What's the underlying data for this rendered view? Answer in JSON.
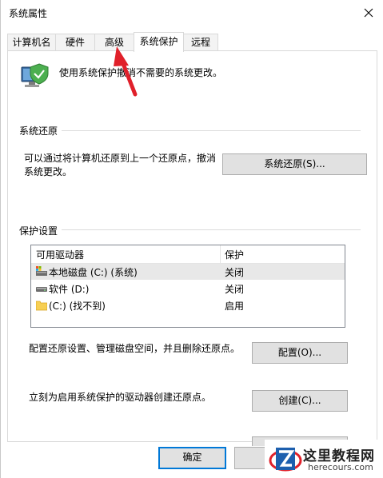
{
  "window": {
    "title": "系统属性"
  },
  "tabs": [
    {
      "label": "计算机名",
      "active": false
    },
    {
      "label": "硬件",
      "active": false
    },
    {
      "label": "高级",
      "active": false
    },
    {
      "label": "系统保护",
      "active": true
    },
    {
      "label": "远程",
      "active": false
    }
  ],
  "description": "使用系统保护撤消不需要的系统更改。",
  "restore": {
    "group_label": "系统还原",
    "text_line1": "可以通过将计算机还原到上一个还原点，撤消",
    "text_line2": "系统更改。",
    "button": "系统还原(S)..."
  },
  "protection": {
    "group_label": "保护设置",
    "col_drive": "可用驱动器",
    "col_protection": "保护",
    "rows": [
      {
        "name": "本地磁盘 (C:) (系统)",
        "protection": "关闭",
        "icon": "system-drive-icon"
      },
      {
        "name": "软件 (D:)",
        "protection": "关闭",
        "icon": "drive-icon"
      },
      {
        "name": "(C:) (找不到)",
        "protection": "启用",
        "icon": "folder-icon"
      }
    ]
  },
  "configure": {
    "text": "配置还原设置、管理磁盘空间，并且删除还原点。",
    "button": "配置(O)..."
  },
  "create": {
    "text": "立刻为启用系统保护的驱动器创建还原点。",
    "button": "创建(C)..."
  },
  "footer": {
    "ok_button": "确定"
  },
  "watermark": {
    "title": "这里教程网",
    "url": "herecours.com"
  },
  "colors": {
    "accent": "#0078d7",
    "arrow": "#e0202a"
  }
}
